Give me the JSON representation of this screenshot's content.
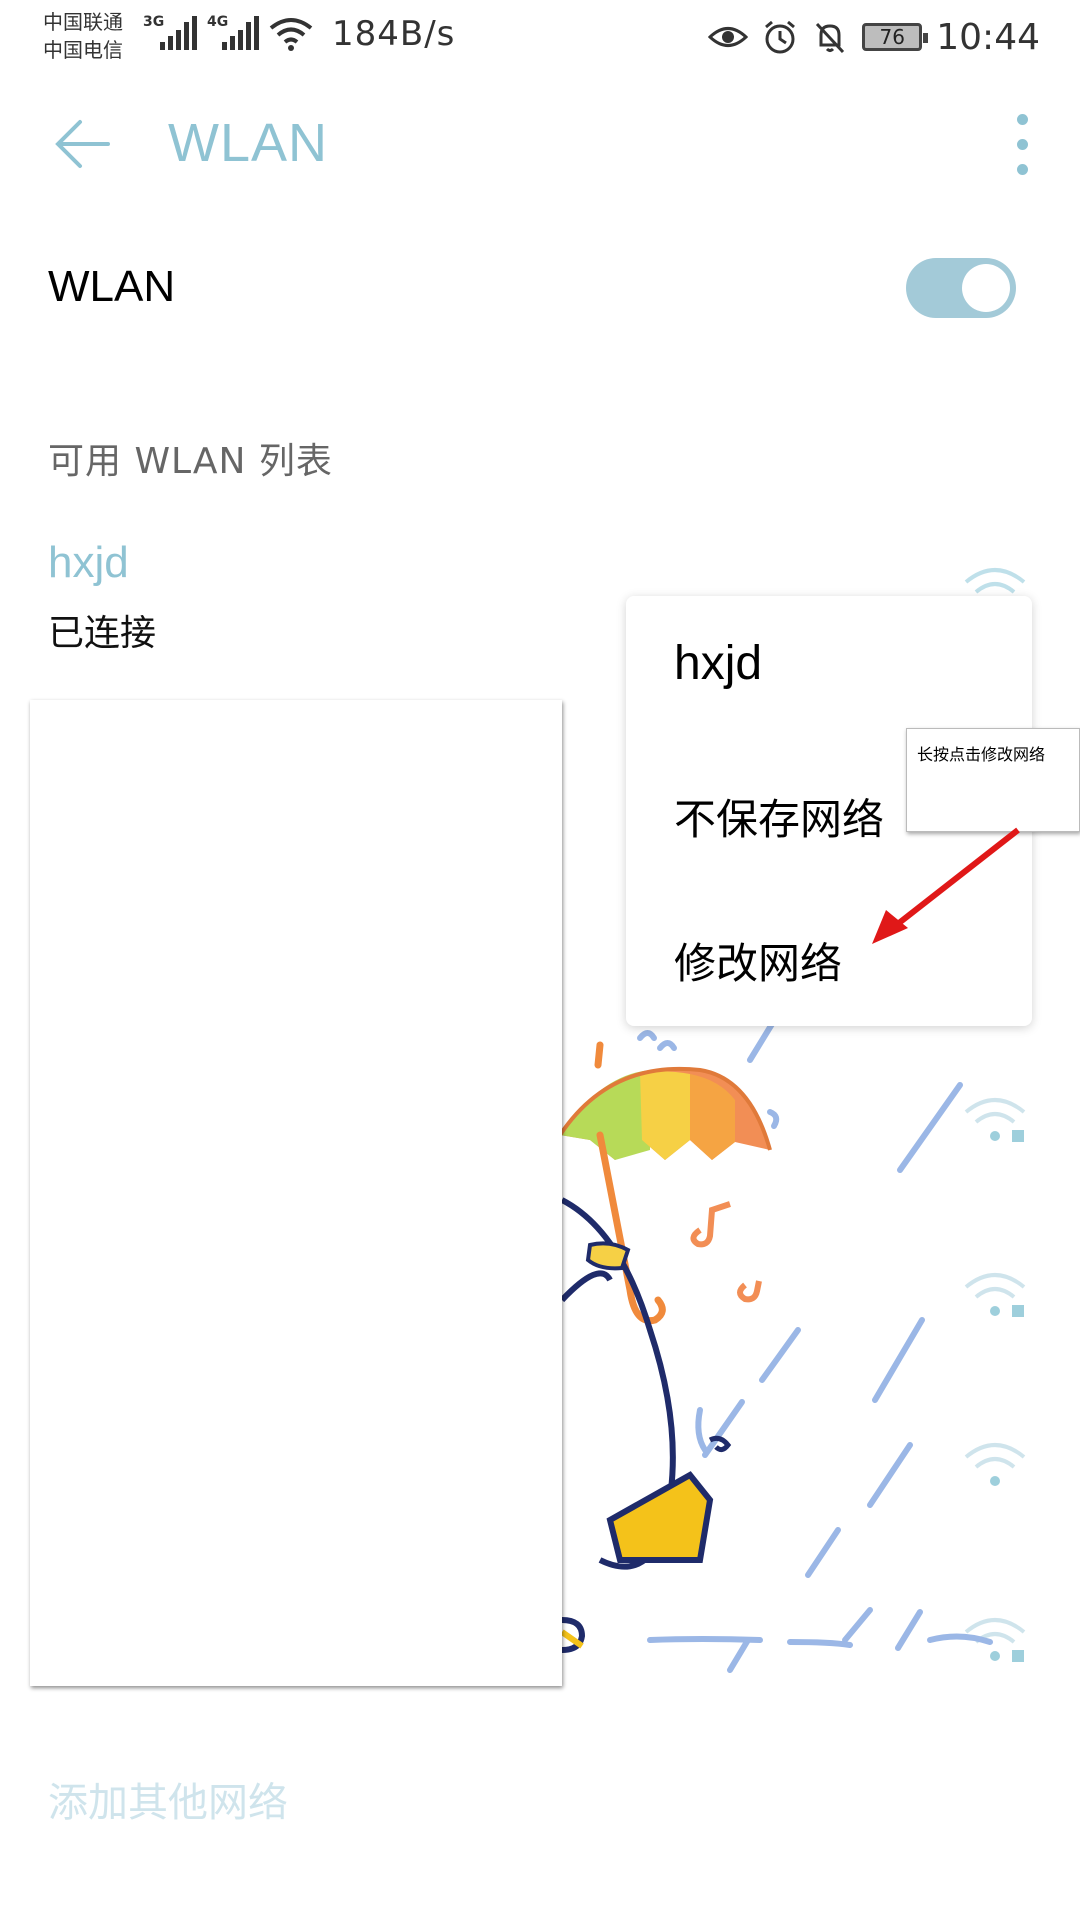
{
  "status_bar": {
    "carrier_1": "中国联通",
    "carrier_2": "中国电信",
    "net_1": "3G",
    "net_2": "4G",
    "speed": "184B/s",
    "battery": "76",
    "time": "10:44"
  },
  "app_bar": {
    "title": "WLAN"
  },
  "wlan_toggle": {
    "label": "WLAN",
    "on": true
  },
  "section_title": "可用 WLAN 列表",
  "connected_network": {
    "name": "hxjd",
    "status": "已连接"
  },
  "popup_menu": {
    "title": "hxjd",
    "items": [
      "不保存网络",
      "修改网络"
    ]
  },
  "callout": {
    "text": "长按点击修改网络"
  },
  "add_network_label": "添加其他网络",
  "colors": {
    "accent": "#8fc3d3",
    "toggle_on": "#a3cad8",
    "arrow": "#e01818"
  }
}
